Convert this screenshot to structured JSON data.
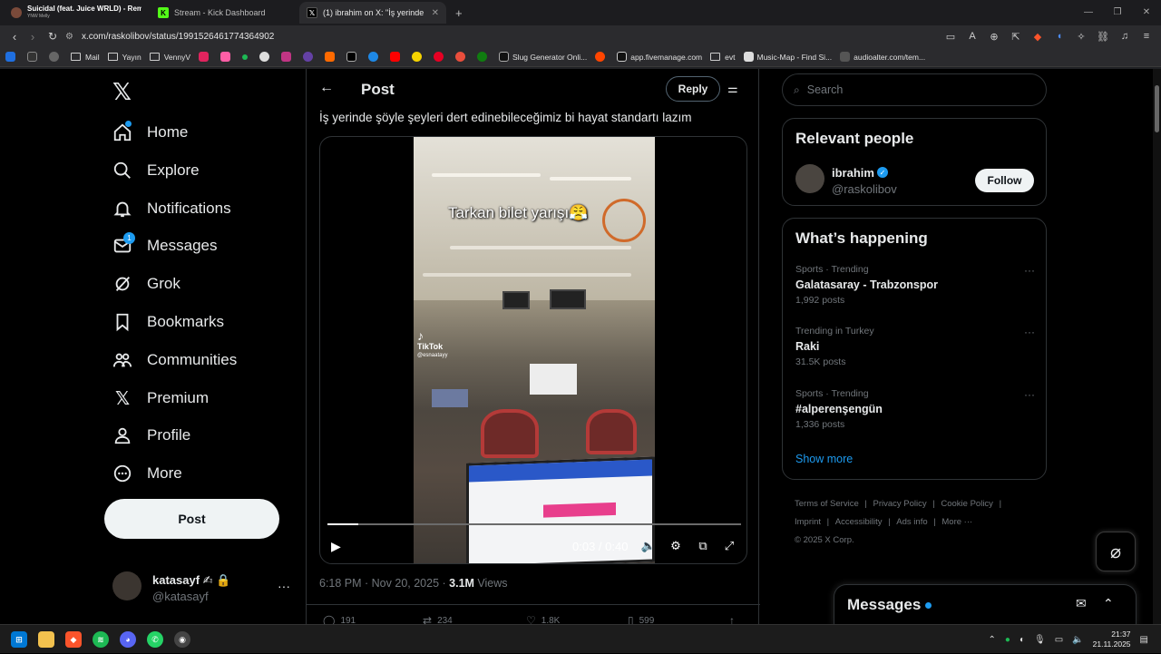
{
  "browser": {
    "tabs": [
      {
        "title": "Suicidal (feat. Juice WRLD) - Remix",
        "subtitle": "YNW Melly"
      },
      {
        "title": "Stream - Kick Dashboard"
      },
      {
        "title": "(1) ibrahim on X: \"İş yerinde şöyl"
      }
    ],
    "url": "x.com/raskolibov/status/1991526461774364902",
    "bookmarks": [
      "Mail",
      "Yayın",
      "VennyV",
      "Slug Generator Onli...",
      "app.fivemanage.com",
      "evt",
      "Music-Map - Find Si...",
      "audioalter.com/tem..."
    ]
  },
  "sidebar": {
    "items": [
      {
        "label": "Home",
        "icon": "home-icon"
      },
      {
        "label": "Explore",
        "icon": "search-icon"
      },
      {
        "label": "Notifications",
        "icon": "bell-icon"
      },
      {
        "label": "Messages",
        "icon": "mail-icon",
        "badge": "1"
      },
      {
        "label": "Grok",
        "icon": "grok-icon"
      },
      {
        "label": "Bookmarks",
        "icon": "bookmark-icon"
      },
      {
        "label": "Communities",
        "icon": "communities-icon"
      },
      {
        "label": "Premium",
        "icon": "x-logo-icon"
      },
      {
        "label": "Profile",
        "icon": "person-icon"
      },
      {
        "label": "More",
        "icon": "more-circle-icon"
      }
    ],
    "post_button": "Post",
    "account": {
      "name": "katasayf",
      "handle": "@katasayf"
    }
  },
  "post": {
    "header_title": "Post",
    "reply_button": "Reply",
    "text": "İş yerinde şöyle şeyleri dert edinebileceğimiz bi hayat standartı lazım",
    "video": {
      "overlay_text": "Tarkan bilet yarışı😤",
      "watermark": "TikTok",
      "watermark_handle": "@esnaatayy",
      "time": "0:03 / 0:40",
      "progress": 0.075
    },
    "timestamp": "6:18 PM · Nov 20, 2025 · ",
    "views_count": "3.1M",
    "views_label": " Views",
    "stats": {
      "replies": "191",
      "reposts": "234",
      "likes": "1.8K",
      "bookmarks": "599"
    }
  },
  "right": {
    "search_placeholder": "Search",
    "relevant_title": "Relevant people",
    "relevant_person": {
      "name": "ibrahim",
      "handle": "@raskolibov",
      "follow": "Follow"
    },
    "happening_title": "What’s happening",
    "trends": [
      {
        "context": "Sports · Trending",
        "title": "Galatasaray - Trabzonspor",
        "posts": "1,992 posts"
      },
      {
        "context": "Trending in Turkey",
        "title": "Raki",
        "posts": "31.5K posts"
      },
      {
        "context": "Sports · Trending",
        "title": "#alperenşengün",
        "posts": "1,336 posts"
      }
    ],
    "show_more": "Show more",
    "footer": {
      "links": [
        "Terms of Service",
        "Privacy Policy",
        "Cookie Policy",
        "Imprint",
        "Accessibility",
        "Ads info",
        "More ···"
      ],
      "copyright": "© 2025 X Corp."
    }
  },
  "messages_drawer": {
    "title": "Messages"
  },
  "taskbar": {
    "time": "21:37",
    "date": "21.11.2025"
  }
}
